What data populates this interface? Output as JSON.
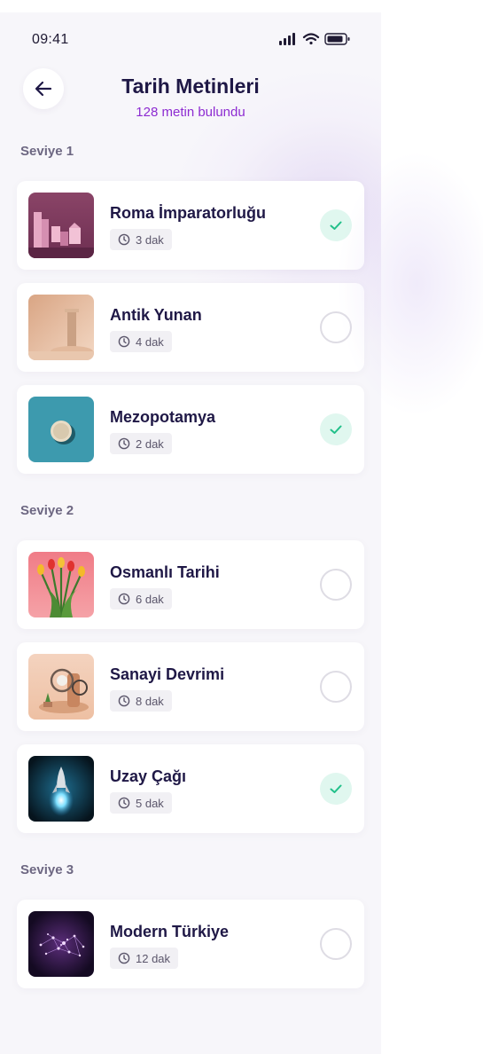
{
  "statusbar": {
    "time": "09:41"
  },
  "header": {
    "title": "Tarih Metinleri",
    "subtitle": "128 metin bulundu"
  },
  "levels": [
    {
      "label": "Seviye 1",
      "items": [
        {
          "title": "Roma İmparatorluğu",
          "duration": "3 dak",
          "completed": true,
          "thumb": "pink-blocks"
        },
        {
          "title": "Antik Yunan",
          "duration": "4 dak",
          "completed": false,
          "thumb": "column"
        },
        {
          "title": "Mezopotamya",
          "duration": "2 dak",
          "completed": true,
          "thumb": "disc"
        }
      ]
    },
    {
      "label": "Seviye 2",
      "items": [
        {
          "title": "Osmanlı Tarihi",
          "duration": "6 dak",
          "completed": false,
          "thumb": "tulips"
        },
        {
          "title": "Sanayi Devrimi",
          "duration": "8 dak",
          "completed": false,
          "thumb": "gears"
        },
        {
          "title": "Uzay Çağı",
          "duration": "5 dak",
          "completed": true,
          "thumb": "rocket"
        }
      ]
    },
    {
      "label": "Seviye 3",
      "items": [
        {
          "title": "Modern Türkiye",
          "duration": "12 dak",
          "completed": false,
          "thumb": "network"
        }
      ]
    }
  ],
  "colors": {
    "accent": "#8d2bd1",
    "title": "#1f1846",
    "check_bg": "#e0f7ef",
    "check": "#22c08a"
  }
}
